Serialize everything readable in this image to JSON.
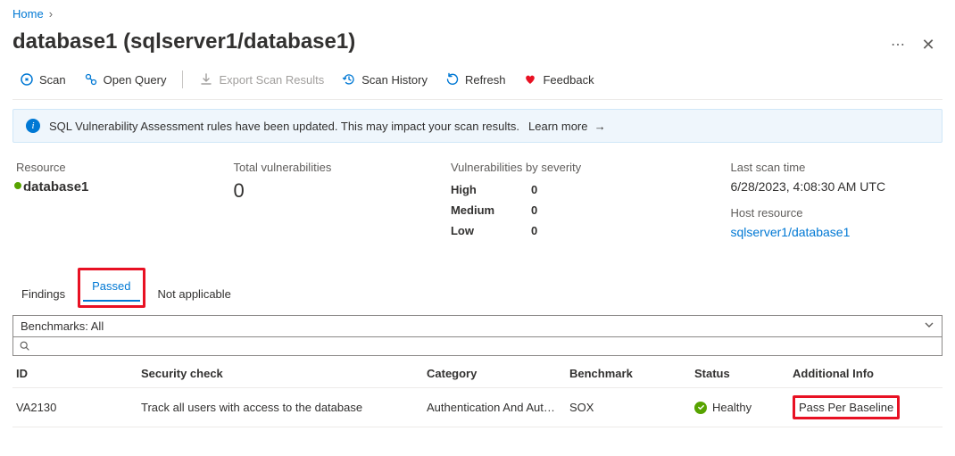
{
  "breadcrumb": {
    "home": "Home"
  },
  "title": "database1 (sqlserver1/database1)",
  "toolbar": {
    "scan": "Scan",
    "open_query": "Open Query",
    "export": "Export Scan Results",
    "history": "Scan History",
    "refresh": "Refresh",
    "feedback": "Feedback"
  },
  "banner": {
    "text": "SQL Vulnerability Assessment rules have been updated. This may impact your scan results.",
    "learn_more": "Learn more"
  },
  "stats": {
    "resource_label": "Resource",
    "resource_name": "database1",
    "total_label": "Total vulnerabilities",
    "total_value": "0",
    "severity_label": "Vulnerabilities by severity",
    "severity": {
      "high_label": "High",
      "high_value": "0",
      "med_label": "Medium",
      "med_value": "0",
      "low_label": "Low",
      "low_value": "0"
    },
    "scan_time_label": "Last scan time",
    "scan_time_value": "6/28/2023, 4:08:30 AM UTC",
    "host_label": "Host resource",
    "host_value": "sqlserver1/database1"
  },
  "tabs": {
    "findings": "Findings",
    "passed": "Passed",
    "na": "Not applicable"
  },
  "filters": {
    "benchmarks": "Benchmarks: All"
  },
  "columns": {
    "id": "ID",
    "sec": "Security check",
    "cat": "Category",
    "bm": "Benchmark",
    "st": "Status",
    "ai": "Additional Info"
  },
  "rows": [
    {
      "id": "VA2130",
      "sec": "Track all users with access to the database",
      "cat": "Authentication And Aut…",
      "bm": "SOX",
      "st": "Healthy",
      "ai": "Pass Per Baseline"
    }
  ]
}
